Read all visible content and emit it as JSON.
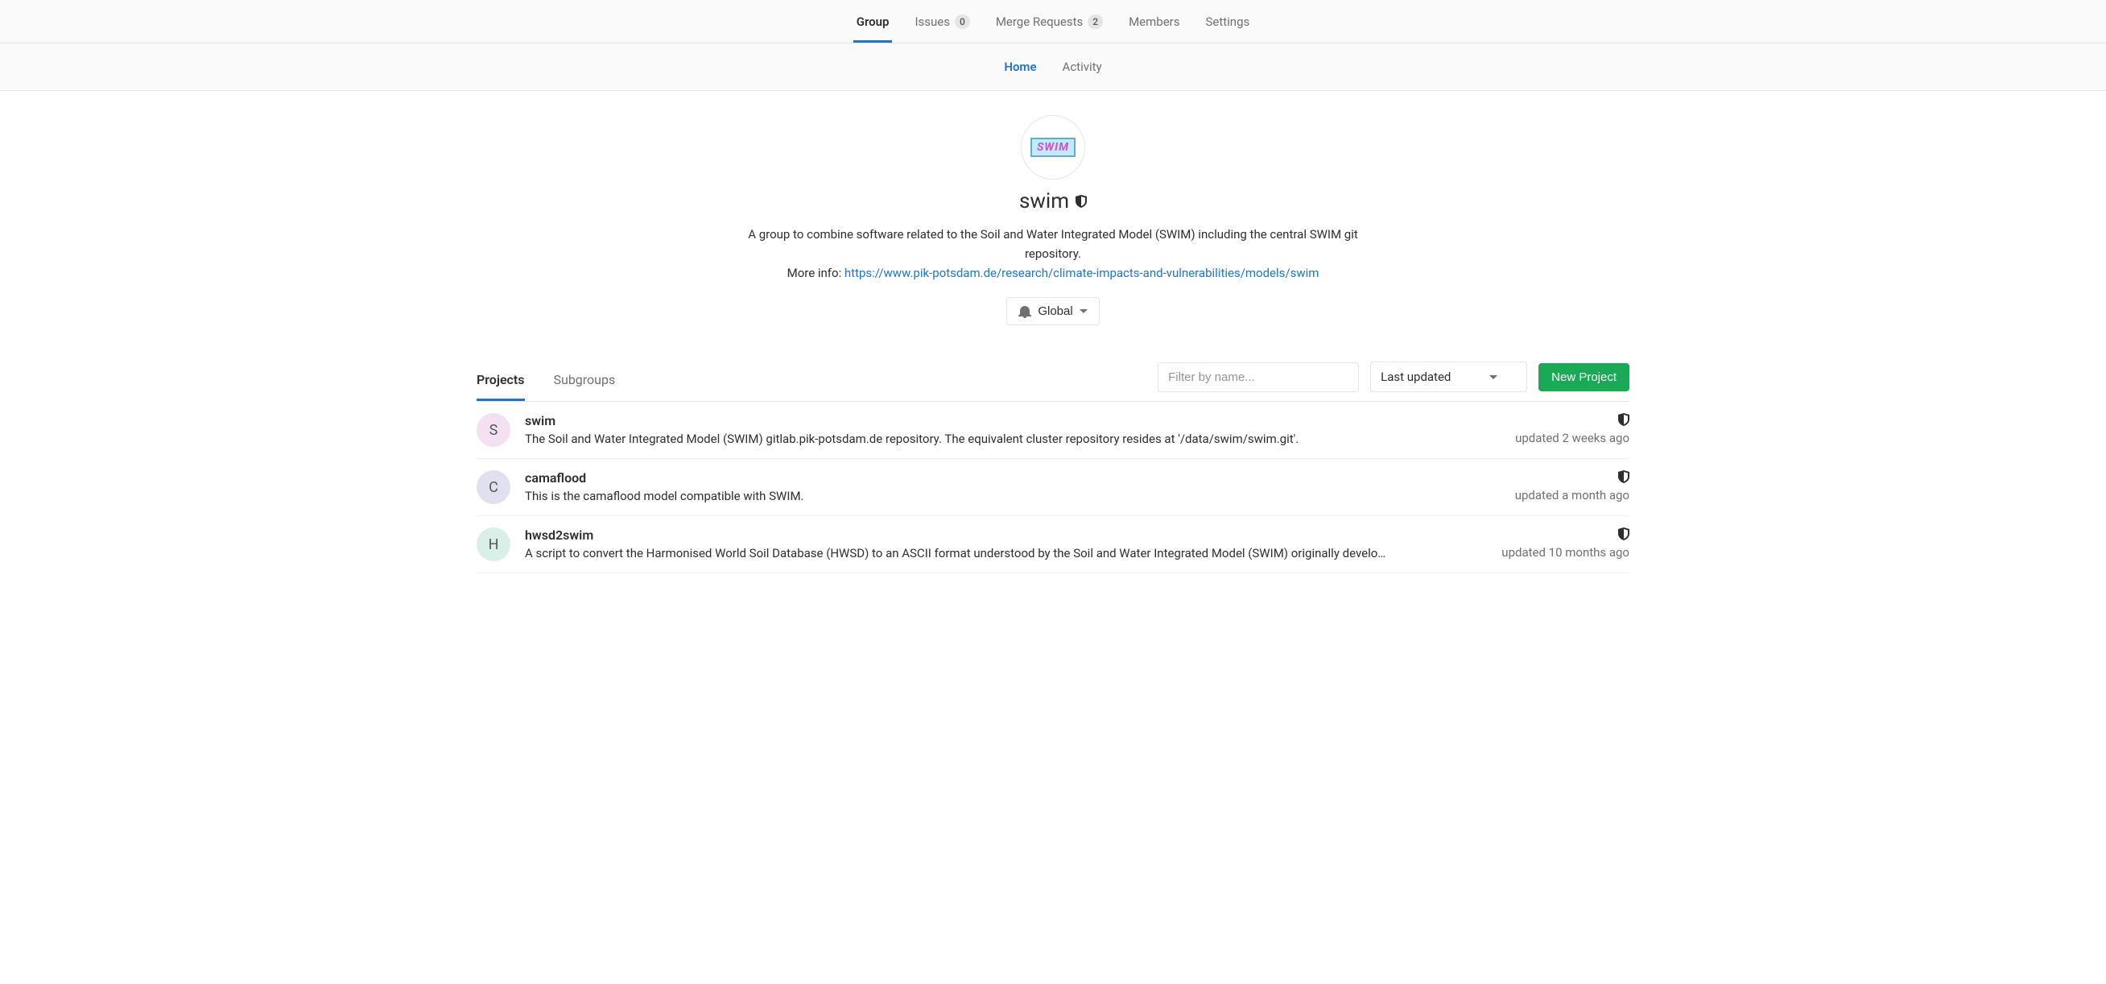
{
  "topTabs": {
    "group": "Group",
    "issues": "Issues",
    "issuesCount": "0",
    "mergeRequests": "Merge Requests",
    "mergeRequestsCount": "2",
    "members": "Members",
    "settings": "Settings"
  },
  "subTabs": {
    "home": "Home",
    "activity": "Activity"
  },
  "group": {
    "avatarText": "SWIM",
    "name": "swim",
    "desc1": "A group to combine software related to the Soil and Water Integrated Model (SWIM) including the central SWIM git repository.",
    "desc2prefix": "More info: ",
    "desc2link": "https://www.pik-potsdam.de/research/climate-impacts-and-vulnerabilities/models/swim",
    "notifLabel": "Global"
  },
  "listTabs": {
    "projects": "Projects",
    "subgroups": "Subgroups"
  },
  "controls": {
    "filterPlaceholder": "Filter by name...",
    "sortLabel": "Last updated",
    "newProject": "New Project"
  },
  "projects": [
    {
      "letter": "S",
      "avClass": "av-s",
      "name": "swim",
      "desc": "The Soil and Water Integrated Model (SWIM) gitlab.pik-potsdam.de repository. The equivalent cluster repository resides at '/data/swim/swim.git'.",
      "updated": "updated 2 weeks ago"
    },
    {
      "letter": "C",
      "avClass": "av-c",
      "name": "camaflood",
      "desc": "This is the camaflood model compatible with SWIM.",
      "updated": "updated a month ago"
    },
    {
      "letter": "H",
      "avClass": "av-h",
      "name": "hwsd2swim",
      "desc": "A script to convert the Harmonised World Soil Database (HWSD) to an ASCII format understood by the Soil and Water Integrated Model (SWIM) originally develo…",
      "updated": "updated 10 months ago"
    }
  ]
}
